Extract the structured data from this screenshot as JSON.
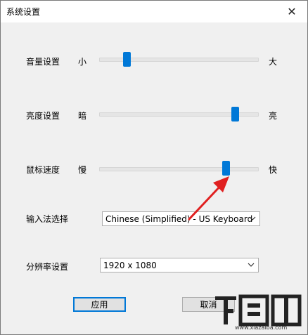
{
  "window": {
    "title": "系统设置",
    "close_glyph": "✕"
  },
  "sliders": [
    {
      "label": "音量设置",
      "min_label": "小",
      "max_label": "大",
      "value": 0.16
    },
    {
      "label": "亮度设置",
      "min_label": "暗",
      "max_label": "亮",
      "value": 0.88
    },
    {
      "label": "鼠标速度",
      "min_label": "慢",
      "max_label": "快",
      "value": 0.82
    }
  ],
  "input_method": {
    "label": "输入法选择",
    "value": "Chinese (Simplified) - US Keyboard"
  },
  "resolution": {
    "label": "分辨率设置",
    "value": "1920 x 1080"
  },
  "buttons": {
    "apply": "应用",
    "cancel": "取消"
  },
  "colors": {
    "accent": "#0078d7",
    "annotation_arrow": "#e02020"
  },
  "watermark": {
    "text": "下载吧",
    "url": "www.xiazaiba.com"
  }
}
